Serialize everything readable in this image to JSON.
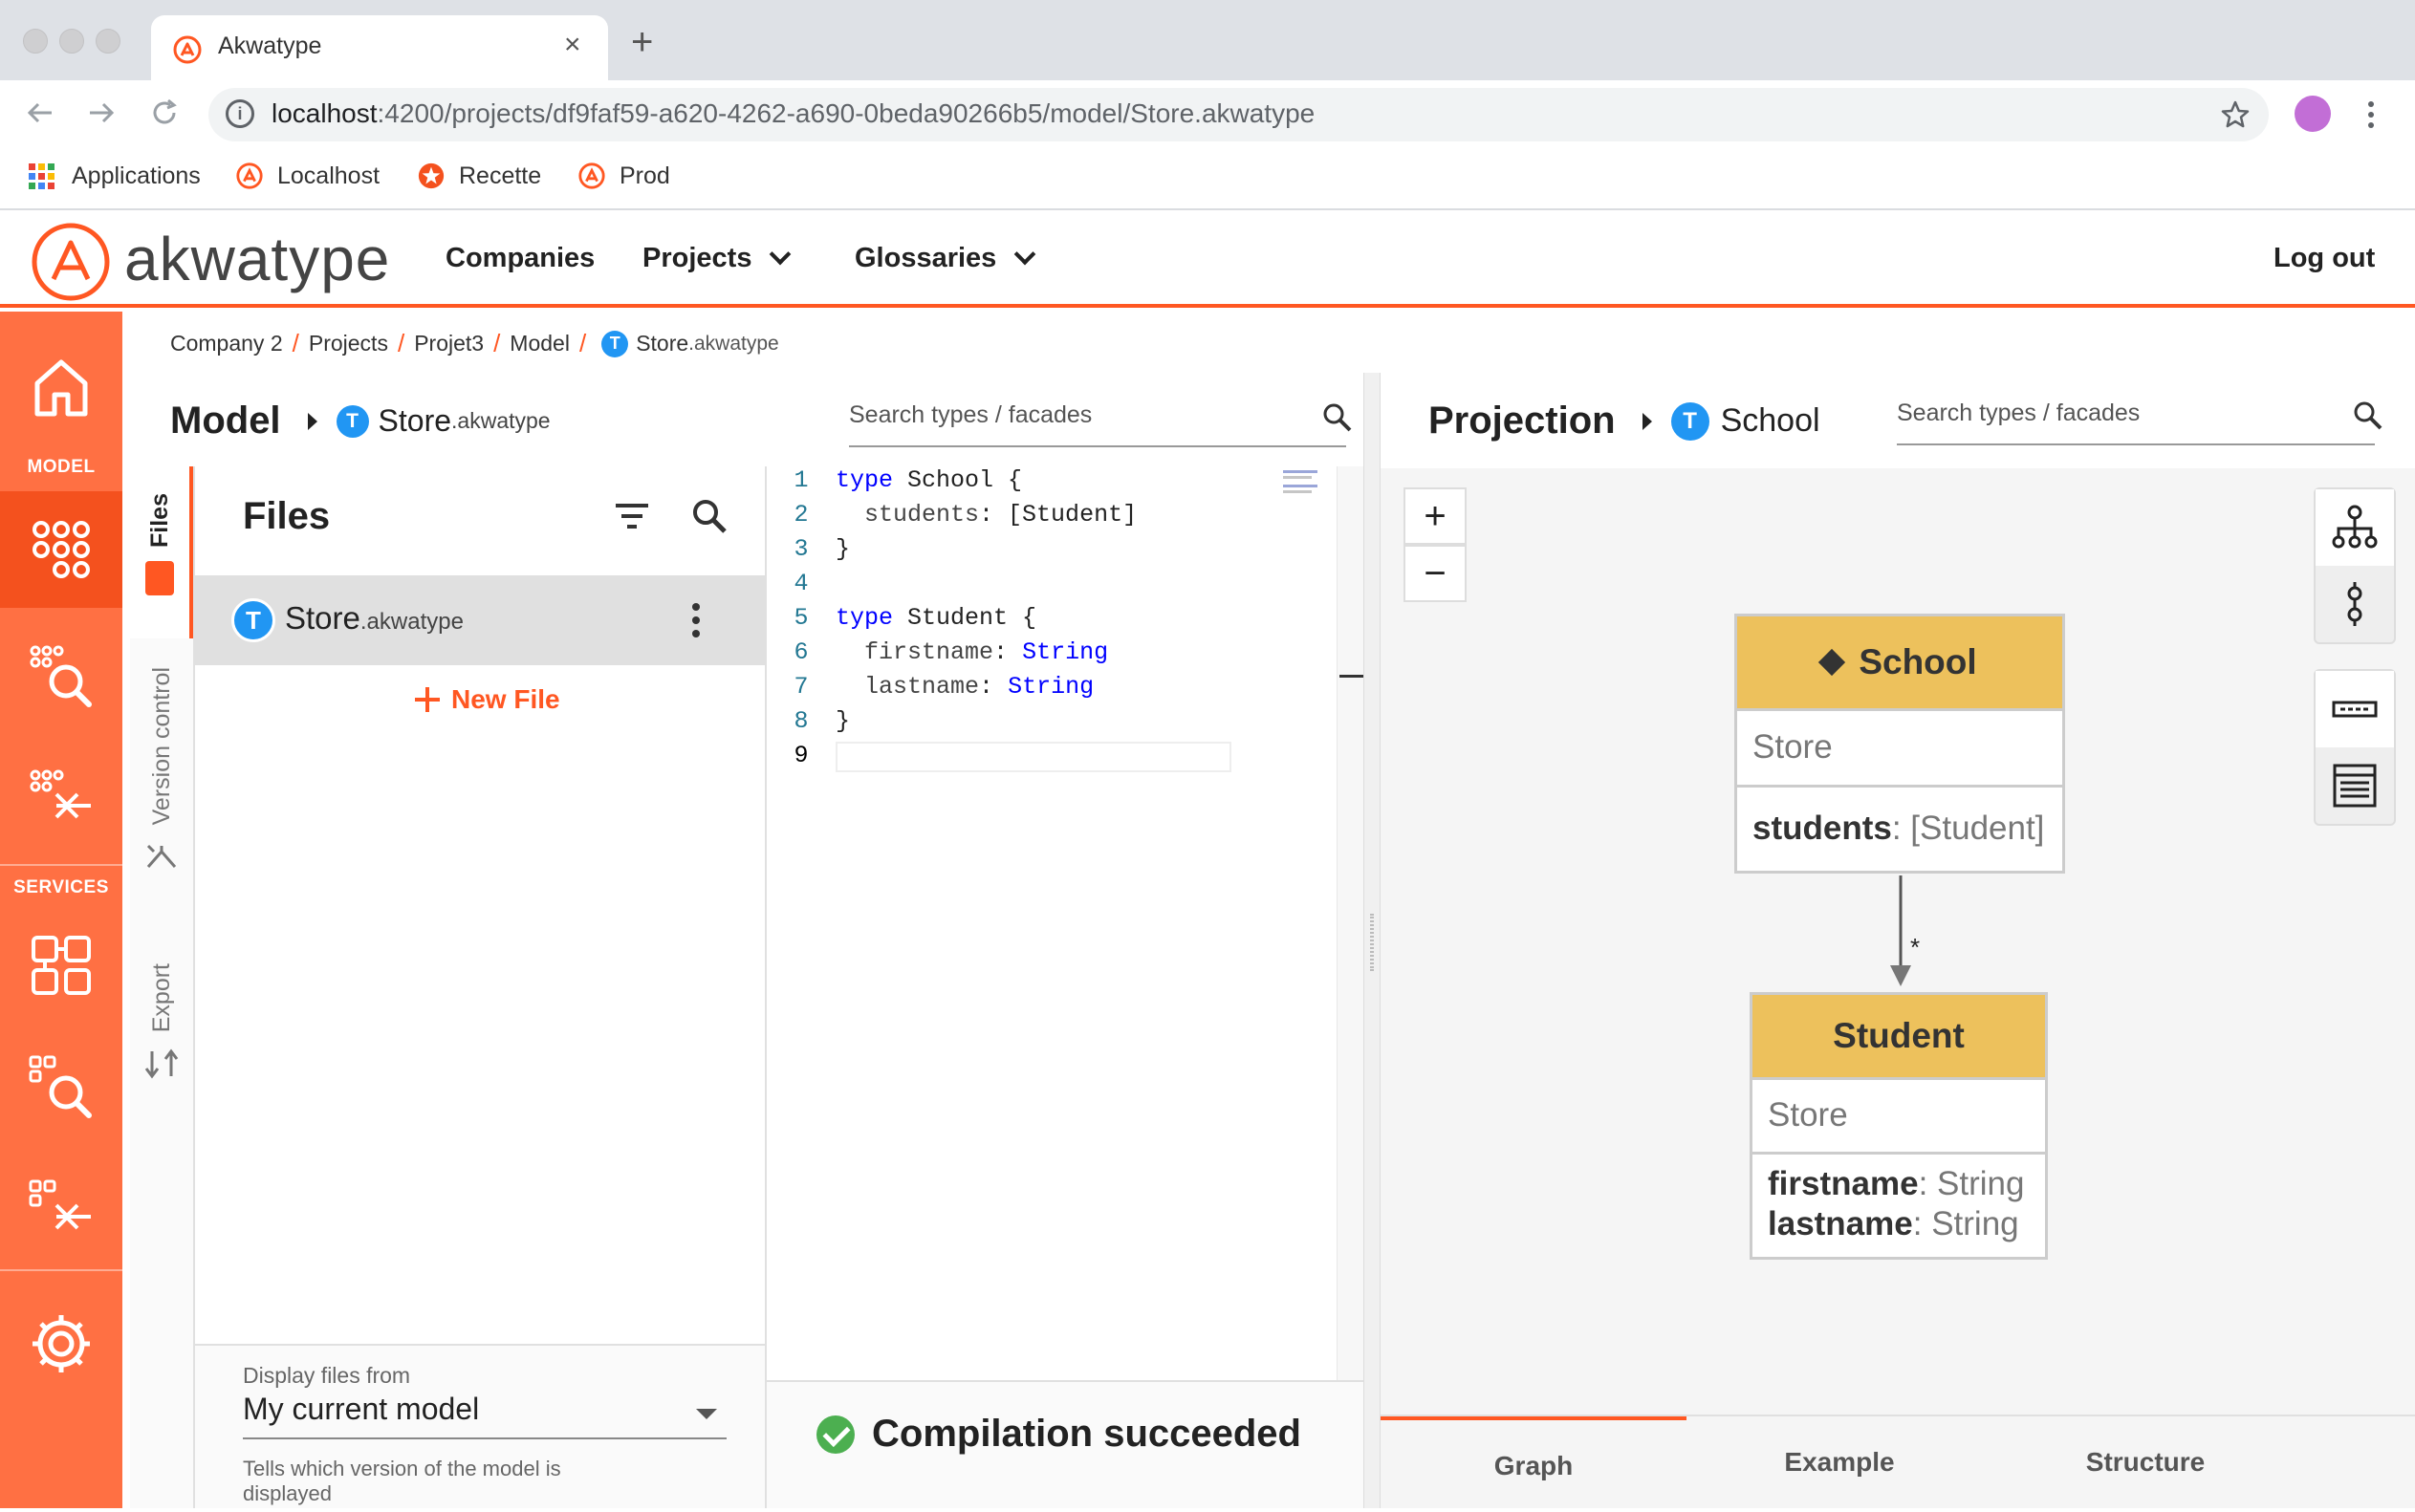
{
  "browser": {
    "tab_title": "Akwatype",
    "tab_close": "×",
    "new_tab": "+",
    "url_host": "localhost",
    "url_rest": ":4200/projects/df9faf59-a620-4262-a690-0beda90266b5/model/Store.akwatype",
    "bookmarks": [
      "Applications",
      "Localhost",
      "Recette",
      "Prod"
    ]
  },
  "app": {
    "logo_text": "akwatype",
    "nav": {
      "companies": "Companies",
      "projects": "Projects",
      "glossaries": "Glossaries"
    },
    "logout": "Log out",
    "accent": "#ff5722"
  },
  "sidebar": {
    "model_label": "MODEL",
    "services_label": "SERVICES"
  },
  "breadcrumb": [
    "Company 2",
    "Projects",
    "Projet3",
    "Model"
  ],
  "breadcrumb_file": {
    "badge": "T",
    "name": "Store",
    "ext": ".akwatype"
  },
  "model": {
    "title": "Model",
    "badge": "T",
    "file_name": "Store",
    "file_ext": ".akwatype",
    "vtabs": {
      "files": "Files",
      "version": "Version control",
      "export": "Export"
    },
    "files_title": "Files",
    "new_file": "New File",
    "display_label": "Display files from",
    "display_value": "My current model",
    "display_hint": "Tells which version of the model is displayed"
  },
  "editor": {
    "search_placeholder": "Search types / facades",
    "compile_status": "Compilation succeeded"
  },
  "projection": {
    "title": "Projection",
    "badge": "T",
    "type_name": "School",
    "search_placeholder": "Search types / facades",
    "zoom_in": "+",
    "zoom_out": "−",
    "school": {
      "name": "School",
      "package": "Store",
      "field": "students",
      "field_type": ": [Student]"
    },
    "multiplicity": "*",
    "student": {
      "name": "Student",
      "package": "Store",
      "f1": "firstname",
      "f1_type": ": String",
      "f2": "lastname",
      "f2_type": ": String"
    },
    "tabs": [
      "Graph",
      "Example",
      "Structure"
    ]
  }
}
